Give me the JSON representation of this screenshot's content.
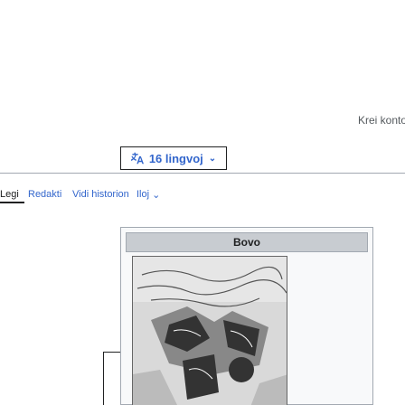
{
  "header": {
    "contributions_link": "Krei konto"
  },
  "language_button": {
    "label": "16 lingvoj",
    "icon": "translate-icon"
  },
  "tabs": {
    "read": "Legi",
    "edit": "Redakti",
    "history": "Vidi historion",
    "tools": "Iloj"
  },
  "infobox": {
    "title": "Bovo"
  }
}
